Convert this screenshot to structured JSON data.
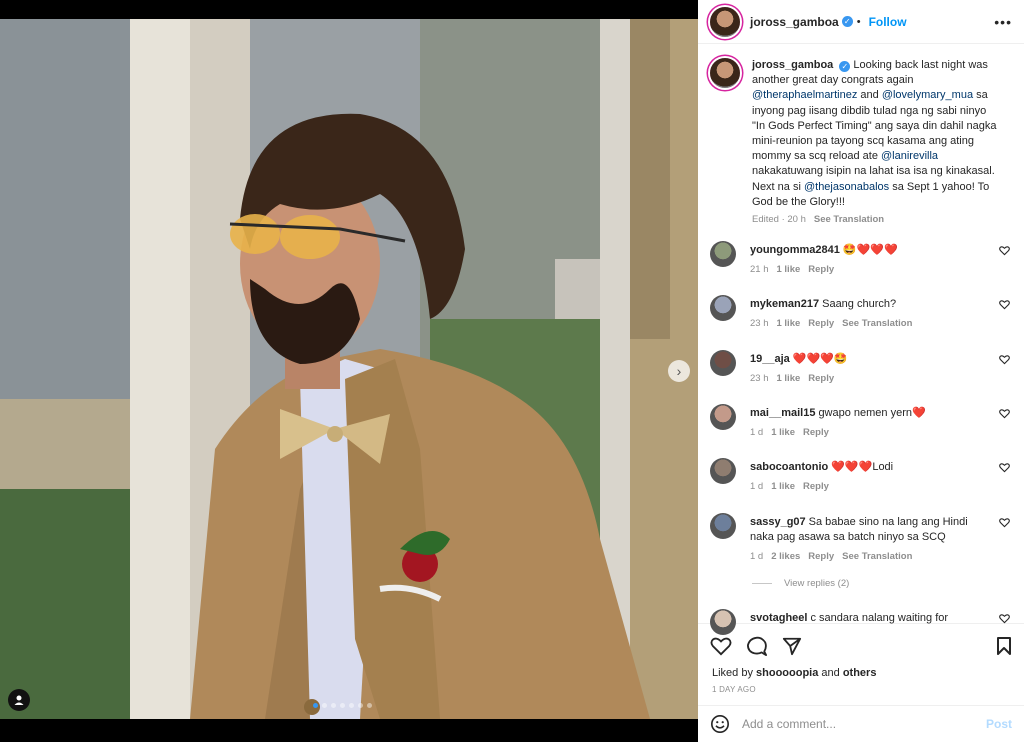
{
  "post": {
    "username": "joross_gamboa",
    "follow_label": "Follow",
    "more_label": "•••",
    "caption_parts": [
      {
        "type": "text",
        "value": "Looking back last night was another great day congrats again "
      },
      {
        "type": "mention",
        "value": "@theraphaelmartinez"
      },
      {
        "type": "text",
        "value": " and "
      },
      {
        "type": "mention",
        "value": "@lovelymary_mua"
      },
      {
        "type": "text",
        "value": " sa inyong pag iisang dibdib tulad nga ng sabi ninyo \"In Gods Perfect Timing\" ang saya din dahil nagka mini-reunion pa tayong scq kasama ang ating mommy sa scq reload ate "
      },
      {
        "type": "mention",
        "value": "@lanirevilla"
      },
      {
        "type": "text",
        "value": " nakakatuwang isipin na lahat isa isa ng kinakasal. Next na si "
      },
      {
        "type": "mention",
        "value": "@thejasonabalos"
      },
      {
        "type": "text",
        "value": " sa Sept 1 yahoo! To God be the Glory!!!"
      }
    ],
    "caption_meta": {
      "edited": "Edited · 20 h",
      "see_translation": "See Translation"
    }
  },
  "comments": [
    {
      "user": "youngomma2841",
      "text": "🤩❤️❤️❤️",
      "time": "21 h",
      "likes": "1 like",
      "reply": "Reply",
      "translation": ""
    },
    {
      "user": "mykeman217",
      "text": "Saang church?",
      "time": "23 h",
      "likes": "1 like",
      "reply": "Reply",
      "translation": "See Translation"
    },
    {
      "user": "19__aja",
      "text": "❤️❤️❤️🤩",
      "time": "23 h",
      "likes": "1 like",
      "reply": "Reply",
      "translation": ""
    },
    {
      "user": "mai__mail15",
      "text": "gwapo nemen yern❤️",
      "time": "1 d",
      "likes": "1 like",
      "reply": "Reply",
      "translation": ""
    },
    {
      "user": "sabocoantonio",
      "text": "❤️❤️❤️Lodi",
      "time": "1 d",
      "likes": "1 like",
      "reply": "Reply",
      "translation": ""
    },
    {
      "user": "sassy_g07",
      "text": "Sa babae sino na lang ang Hindi naka pag asawa sa batch ninyo sa SCQ",
      "time": "1 d",
      "likes": "2 likes",
      "reply": "Reply",
      "translation": "See Translation"
    },
    {
      "user": "svotagheel",
      "text": "c sandara nalang waiting for",
      "time": "",
      "likes": "",
      "reply": "",
      "translation": ""
    }
  ],
  "view_replies": "View replies (2)",
  "likes_line": {
    "prefix": "Liked by ",
    "user": "shooooopia",
    "middle": " and ",
    "others": "others"
  },
  "post_date": "1 DAY AGO",
  "add_comment": {
    "placeholder": "Add a comment...",
    "post_label": "Post"
  },
  "carousel": {
    "slide_count": 7,
    "active_index": 0
  },
  "colors": {
    "link": "#0095f6",
    "mention": "#00376b",
    "heart": "#ed4956",
    "verified": "#3897f0"
  }
}
